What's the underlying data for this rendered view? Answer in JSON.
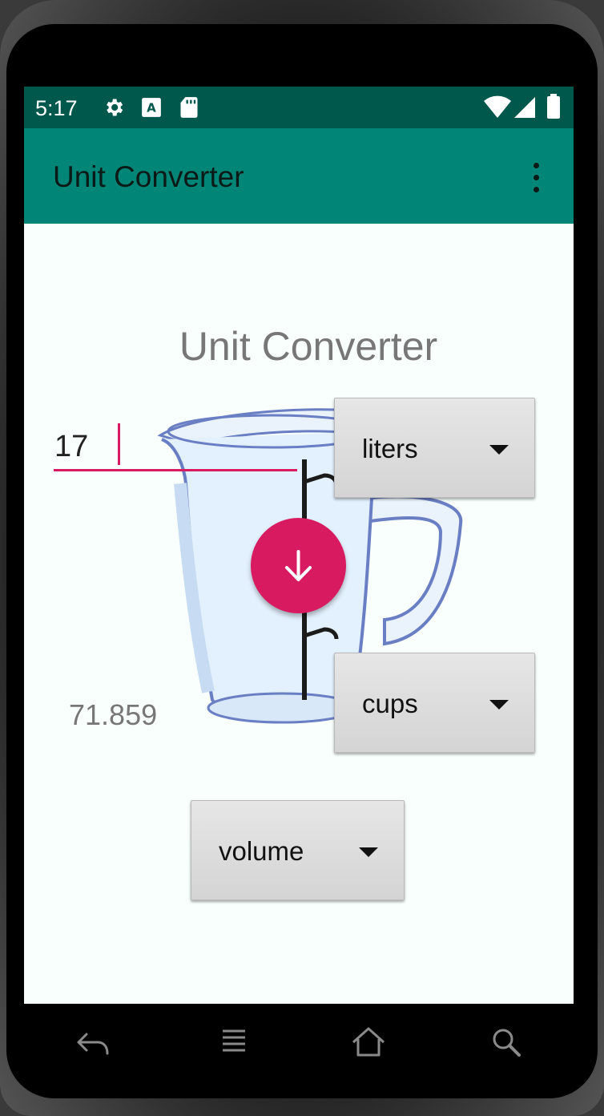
{
  "status_bar": {
    "time": "5:17",
    "icons": [
      "settings-icon",
      "keyboard-a-icon",
      "sd-card-icon",
      "wifi-icon",
      "signal-icon",
      "battery-icon"
    ]
  },
  "app_bar": {
    "title": "Unit Converter",
    "menu_icon": "more-vert-icon",
    "background": "#008577",
    "status_background": "#00574b"
  },
  "main": {
    "heading": "Unit Converter",
    "input": {
      "value": "17"
    },
    "from_unit": {
      "selected": "liters"
    },
    "to_unit": {
      "selected": "cups"
    },
    "category": {
      "selected": "volume"
    },
    "convert_button": {
      "icon": "arrow-down-icon",
      "color": "#d81b60"
    },
    "result": "71.859"
  },
  "nav_bar": {
    "icons": [
      "back-icon",
      "menu-icon",
      "home-icon",
      "search-icon"
    ]
  }
}
